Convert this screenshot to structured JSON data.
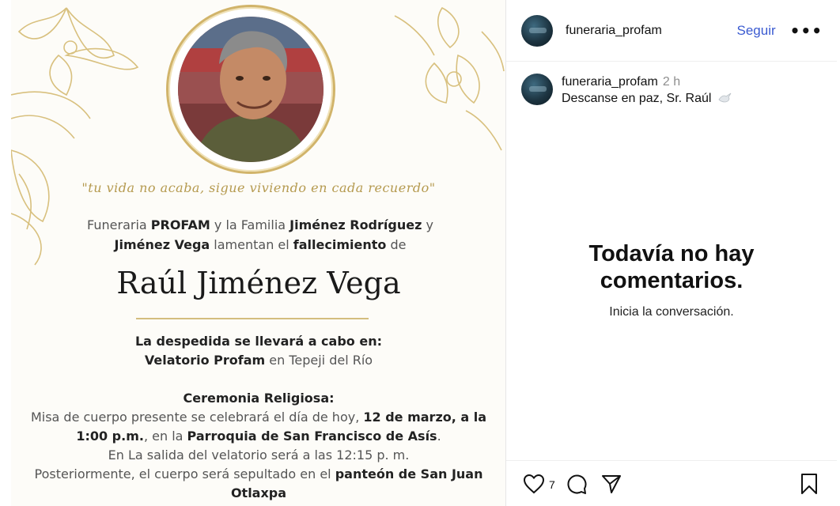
{
  "post": {
    "quote": "\"tu vida no acaba, sigue viviendo en cada recuerdo\"",
    "announce": {
      "l1_a": "Funeraria ",
      "l1_b": "PROFAM",
      "l1_c": " y la Familia ",
      "l1_d": "Jiménez Rodríguez",
      "l1_e": " y",
      "l2_a": "Jiménez Vega",
      "l2_b": "  lamentan el ",
      "l2_c": "fallecimiento",
      "l2_d": " de"
    },
    "deceased_name": "Raúl Jiménez Vega",
    "farewell": {
      "heading": "La despedida se llevará a cabo en:",
      "venue": "Velatorio Profam",
      "place": " en Tepeji del Río"
    },
    "ceremony": {
      "heading": "Ceremonia Religiosa:",
      "l1_a": "Misa de cuerpo presente se celebrará el día de hoy, ",
      "l1_b": "12 de marzo, a la",
      "l2_a": "1:00 p.m.",
      "l2_b": ", en la ",
      "l2_c": "Parroquia  de San Francisco de Asís",
      "l2_d": ".",
      "l3": "En La salida del velatorio será a las 12:15 p. m.",
      "l4_a": "Posteriormente, el cuerpo será sepultado en el ",
      "l4_b": "panteón de San Juan",
      "l5": "Otlaxpa"
    }
  },
  "header": {
    "username": "funeraria_profam",
    "follow_label": "Seguir",
    "more_label": "•••"
  },
  "caption": {
    "username": "funeraria_profam",
    "time": "2 h",
    "text": "Descanse en paz, Sr. Raúl"
  },
  "comments": {
    "empty_title_1": "Todavía no hay",
    "empty_title_2": "comentarios.",
    "empty_sub": "Inicia la conversación."
  },
  "actions": {
    "like_count": "7"
  },
  "colors": {
    "accent": "#3b5bd1",
    "gold": "#d1b46a"
  }
}
